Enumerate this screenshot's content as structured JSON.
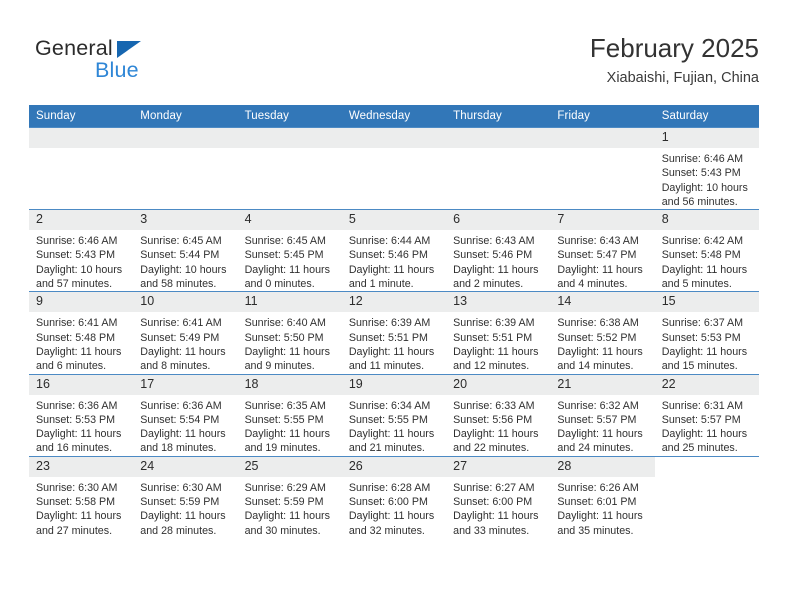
{
  "brand": {
    "name_part1": "General",
    "name_part2": "Blue",
    "accent_color": "#2e86d6",
    "triangle_color": "#1666b0"
  },
  "header": {
    "title": "February 2025",
    "subtitle": "Xiabaishi, Fujian, China"
  },
  "calendar": {
    "header_bg": "#3277b8",
    "daynum_bg": "#eceded",
    "row_border": "#4c8ac4",
    "weekdays": [
      "Sunday",
      "Monday",
      "Tuesday",
      "Wednesday",
      "Thursday",
      "Friday",
      "Saturday"
    ],
    "weeks": [
      [
        {
          "type": "blank"
        },
        {
          "type": "blank"
        },
        {
          "type": "blank"
        },
        {
          "type": "blank"
        },
        {
          "type": "blank"
        },
        {
          "type": "blank"
        },
        {
          "type": "day",
          "day": "1",
          "sunrise": "Sunrise: 6:46 AM",
          "sunset": "Sunset: 5:43 PM",
          "daylight1": "Daylight: 10 hours",
          "daylight2": "and 56 minutes."
        }
      ],
      [
        {
          "type": "day",
          "day": "2",
          "sunrise": "Sunrise: 6:46 AM",
          "sunset": "Sunset: 5:43 PM",
          "daylight1": "Daylight: 10 hours",
          "daylight2": "and 57 minutes."
        },
        {
          "type": "day",
          "day": "3",
          "sunrise": "Sunrise: 6:45 AM",
          "sunset": "Sunset: 5:44 PM",
          "daylight1": "Daylight: 10 hours",
          "daylight2": "and 58 minutes."
        },
        {
          "type": "day",
          "day": "4",
          "sunrise": "Sunrise: 6:45 AM",
          "sunset": "Sunset: 5:45 PM",
          "daylight1": "Daylight: 11 hours",
          "daylight2": "and 0 minutes."
        },
        {
          "type": "day",
          "day": "5",
          "sunrise": "Sunrise: 6:44 AM",
          "sunset": "Sunset: 5:46 PM",
          "daylight1": "Daylight: 11 hours",
          "daylight2": "and 1 minute."
        },
        {
          "type": "day",
          "day": "6",
          "sunrise": "Sunrise: 6:43 AM",
          "sunset": "Sunset: 5:46 PM",
          "daylight1": "Daylight: 11 hours",
          "daylight2": "and 2 minutes."
        },
        {
          "type": "day",
          "day": "7",
          "sunrise": "Sunrise: 6:43 AM",
          "sunset": "Sunset: 5:47 PM",
          "daylight1": "Daylight: 11 hours",
          "daylight2": "and 4 minutes."
        },
        {
          "type": "day",
          "day": "8",
          "sunrise": "Sunrise: 6:42 AM",
          "sunset": "Sunset: 5:48 PM",
          "daylight1": "Daylight: 11 hours",
          "daylight2": "and 5 minutes."
        }
      ],
      [
        {
          "type": "day",
          "day": "9",
          "sunrise": "Sunrise: 6:41 AM",
          "sunset": "Sunset: 5:48 PM",
          "daylight1": "Daylight: 11 hours",
          "daylight2": "and 6 minutes."
        },
        {
          "type": "day",
          "day": "10",
          "sunrise": "Sunrise: 6:41 AM",
          "sunset": "Sunset: 5:49 PM",
          "daylight1": "Daylight: 11 hours",
          "daylight2": "and 8 minutes."
        },
        {
          "type": "day",
          "day": "11",
          "sunrise": "Sunrise: 6:40 AM",
          "sunset": "Sunset: 5:50 PM",
          "daylight1": "Daylight: 11 hours",
          "daylight2": "and 9 minutes."
        },
        {
          "type": "day",
          "day": "12",
          "sunrise": "Sunrise: 6:39 AM",
          "sunset": "Sunset: 5:51 PM",
          "daylight1": "Daylight: 11 hours",
          "daylight2": "and 11 minutes."
        },
        {
          "type": "day",
          "day": "13",
          "sunrise": "Sunrise: 6:39 AM",
          "sunset": "Sunset: 5:51 PM",
          "daylight1": "Daylight: 11 hours",
          "daylight2": "and 12 minutes."
        },
        {
          "type": "day",
          "day": "14",
          "sunrise": "Sunrise: 6:38 AM",
          "sunset": "Sunset: 5:52 PM",
          "daylight1": "Daylight: 11 hours",
          "daylight2": "and 14 minutes."
        },
        {
          "type": "day",
          "day": "15",
          "sunrise": "Sunrise: 6:37 AM",
          "sunset": "Sunset: 5:53 PM",
          "daylight1": "Daylight: 11 hours",
          "daylight2": "and 15 minutes."
        }
      ],
      [
        {
          "type": "day",
          "day": "16",
          "sunrise": "Sunrise: 6:36 AM",
          "sunset": "Sunset: 5:53 PM",
          "daylight1": "Daylight: 11 hours",
          "daylight2": "and 16 minutes."
        },
        {
          "type": "day",
          "day": "17",
          "sunrise": "Sunrise: 6:36 AM",
          "sunset": "Sunset: 5:54 PM",
          "daylight1": "Daylight: 11 hours",
          "daylight2": "and 18 minutes."
        },
        {
          "type": "day",
          "day": "18",
          "sunrise": "Sunrise: 6:35 AM",
          "sunset": "Sunset: 5:55 PM",
          "daylight1": "Daylight: 11 hours",
          "daylight2": "and 19 minutes."
        },
        {
          "type": "day",
          "day": "19",
          "sunrise": "Sunrise: 6:34 AM",
          "sunset": "Sunset: 5:55 PM",
          "daylight1": "Daylight: 11 hours",
          "daylight2": "and 21 minutes."
        },
        {
          "type": "day",
          "day": "20",
          "sunrise": "Sunrise: 6:33 AM",
          "sunset": "Sunset: 5:56 PM",
          "daylight1": "Daylight: 11 hours",
          "daylight2": "and 22 minutes."
        },
        {
          "type": "day",
          "day": "21",
          "sunrise": "Sunrise: 6:32 AM",
          "sunset": "Sunset: 5:57 PM",
          "daylight1": "Daylight: 11 hours",
          "daylight2": "and 24 minutes."
        },
        {
          "type": "day",
          "day": "22",
          "sunrise": "Sunrise: 6:31 AM",
          "sunset": "Sunset: 5:57 PM",
          "daylight1": "Daylight: 11 hours",
          "daylight2": "and 25 minutes."
        }
      ],
      [
        {
          "type": "day",
          "day": "23",
          "sunrise": "Sunrise: 6:30 AM",
          "sunset": "Sunset: 5:58 PM",
          "daylight1": "Daylight: 11 hours",
          "daylight2": "and 27 minutes."
        },
        {
          "type": "day",
          "day": "24",
          "sunrise": "Sunrise: 6:30 AM",
          "sunset": "Sunset: 5:59 PM",
          "daylight1": "Daylight: 11 hours",
          "daylight2": "and 28 minutes."
        },
        {
          "type": "day",
          "day": "25",
          "sunrise": "Sunrise: 6:29 AM",
          "sunset": "Sunset: 5:59 PM",
          "daylight1": "Daylight: 11 hours",
          "daylight2": "and 30 minutes."
        },
        {
          "type": "day",
          "day": "26",
          "sunrise": "Sunrise: 6:28 AM",
          "sunset": "Sunset: 6:00 PM",
          "daylight1": "Daylight: 11 hours",
          "daylight2": "and 32 minutes."
        },
        {
          "type": "day",
          "day": "27",
          "sunrise": "Sunrise: 6:27 AM",
          "sunset": "Sunset: 6:00 PM",
          "daylight1": "Daylight: 11 hours",
          "daylight2": "and 33 minutes."
        },
        {
          "type": "day",
          "day": "28",
          "sunrise": "Sunrise: 6:26 AM",
          "sunset": "Sunset: 6:01 PM",
          "daylight1": "Daylight: 11 hours",
          "daylight2": "and 35 minutes."
        },
        {
          "type": "empty"
        }
      ]
    ]
  }
}
